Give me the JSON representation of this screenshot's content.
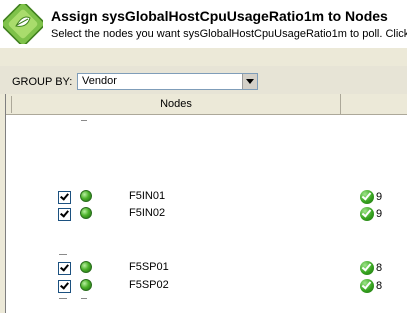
{
  "header": {
    "title": "Assign sysGlobalHostCpuUsageRatio1m to Nodes",
    "subtitle": "Select the nodes you want sysGlobalHostCpuUsageRatio1m to poll. Click \""
  },
  "groupby": {
    "label": "GROUP BY:",
    "selected": "Vendor"
  },
  "grid": {
    "columns": [
      "Nodes",
      ""
    ],
    "rows": [
      {
        "name": "F5IN01",
        "checked": true,
        "count": "9"
      },
      {
        "name": "F5IN02",
        "checked": true,
        "count": "9"
      },
      {
        "name": "F5SP01",
        "checked": true,
        "count": "8"
      },
      {
        "name": "F5SP02",
        "checked": true,
        "count": "8"
      }
    ]
  },
  "colors": {
    "panel": "#ece9d8",
    "status_green": "#4db22b",
    "logo_green": "#5aa832"
  }
}
